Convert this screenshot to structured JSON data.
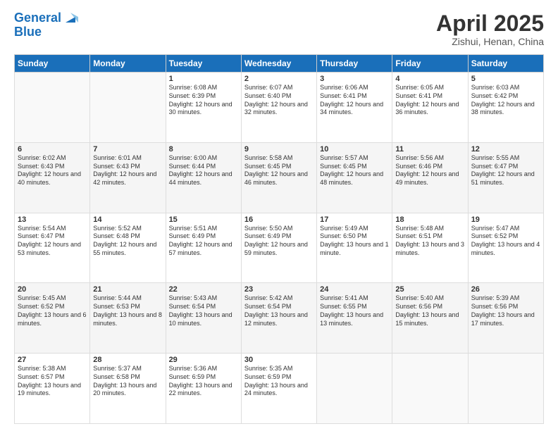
{
  "header": {
    "logo_line1": "General",
    "logo_line2": "Blue",
    "month_title": "April 2025",
    "subtitle": "Zishui, Henan, China"
  },
  "weekdays": [
    "Sunday",
    "Monday",
    "Tuesday",
    "Wednesday",
    "Thursday",
    "Friday",
    "Saturday"
  ],
  "weeks": [
    [
      {
        "day": "",
        "sunrise": "",
        "sunset": "",
        "daylight": ""
      },
      {
        "day": "",
        "sunrise": "",
        "sunset": "",
        "daylight": ""
      },
      {
        "day": "1",
        "sunrise": "Sunrise: 6:08 AM",
        "sunset": "Sunset: 6:39 PM",
        "daylight": "Daylight: 12 hours and 30 minutes."
      },
      {
        "day": "2",
        "sunrise": "Sunrise: 6:07 AM",
        "sunset": "Sunset: 6:40 PM",
        "daylight": "Daylight: 12 hours and 32 minutes."
      },
      {
        "day": "3",
        "sunrise": "Sunrise: 6:06 AM",
        "sunset": "Sunset: 6:41 PM",
        "daylight": "Daylight: 12 hours and 34 minutes."
      },
      {
        "day": "4",
        "sunrise": "Sunrise: 6:05 AM",
        "sunset": "Sunset: 6:41 PM",
        "daylight": "Daylight: 12 hours and 36 minutes."
      },
      {
        "day": "5",
        "sunrise": "Sunrise: 6:03 AM",
        "sunset": "Sunset: 6:42 PM",
        "daylight": "Daylight: 12 hours and 38 minutes."
      }
    ],
    [
      {
        "day": "6",
        "sunrise": "Sunrise: 6:02 AM",
        "sunset": "Sunset: 6:43 PM",
        "daylight": "Daylight: 12 hours and 40 minutes."
      },
      {
        "day": "7",
        "sunrise": "Sunrise: 6:01 AM",
        "sunset": "Sunset: 6:43 PM",
        "daylight": "Daylight: 12 hours and 42 minutes."
      },
      {
        "day": "8",
        "sunrise": "Sunrise: 6:00 AM",
        "sunset": "Sunset: 6:44 PM",
        "daylight": "Daylight: 12 hours and 44 minutes."
      },
      {
        "day": "9",
        "sunrise": "Sunrise: 5:58 AM",
        "sunset": "Sunset: 6:45 PM",
        "daylight": "Daylight: 12 hours and 46 minutes."
      },
      {
        "day": "10",
        "sunrise": "Sunrise: 5:57 AM",
        "sunset": "Sunset: 6:45 PM",
        "daylight": "Daylight: 12 hours and 48 minutes."
      },
      {
        "day": "11",
        "sunrise": "Sunrise: 5:56 AM",
        "sunset": "Sunset: 6:46 PM",
        "daylight": "Daylight: 12 hours and 49 minutes."
      },
      {
        "day": "12",
        "sunrise": "Sunrise: 5:55 AM",
        "sunset": "Sunset: 6:47 PM",
        "daylight": "Daylight: 12 hours and 51 minutes."
      }
    ],
    [
      {
        "day": "13",
        "sunrise": "Sunrise: 5:54 AM",
        "sunset": "Sunset: 6:47 PM",
        "daylight": "Daylight: 12 hours and 53 minutes."
      },
      {
        "day": "14",
        "sunrise": "Sunrise: 5:52 AM",
        "sunset": "Sunset: 6:48 PM",
        "daylight": "Daylight: 12 hours and 55 minutes."
      },
      {
        "day": "15",
        "sunrise": "Sunrise: 5:51 AM",
        "sunset": "Sunset: 6:49 PM",
        "daylight": "Daylight: 12 hours and 57 minutes."
      },
      {
        "day": "16",
        "sunrise": "Sunrise: 5:50 AM",
        "sunset": "Sunset: 6:49 PM",
        "daylight": "Daylight: 12 hours and 59 minutes."
      },
      {
        "day": "17",
        "sunrise": "Sunrise: 5:49 AM",
        "sunset": "Sunset: 6:50 PM",
        "daylight": "Daylight: 13 hours and 1 minute."
      },
      {
        "day": "18",
        "sunrise": "Sunrise: 5:48 AM",
        "sunset": "Sunset: 6:51 PM",
        "daylight": "Daylight: 13 hours and 3 minutes."
      },
      {
        "day": "19",
        "sunrise": "Sunrise: 5:47 AM",
        "sunset": "Sunset: 6:52 PM",
        "daylight": "Daylight: 13 hours and 4 minutes."
      }
    ],
    [
      {
        "day": "20",
        "sunrise": "Sunrise: 5:45 AM",
        "sunset": "Sunset: 6:52 PM",
        "daylight": "Daylight: 13 hours and 6 minutes."
      },
      {
        "day": "21",
        "sunrise": "Sunrise: 5:44 AM",
        "sunset": "Sunset: 6:53 PM",
        "daylight": "Daylight: 13 hours and 8 minutes."
      },
      {
        "day": "22",
        "sunrise": "Sunrise: 5:43 AM",
        "sunset": "Sunset: 6:54 PM",
        "daylight": "Daylight: 13 hours and 10 minutes."
      },
      {
        "day": "23",
        "sunrise": "Sunrise: 5:42 AM",
        "sunset": "Sunset: 6:54 PM",
        "daylight": "Daylight: 13 hours and 12 minutes."
      },
      {
        "day": "24",
        "sunrise": "Sunrise: 5:41 AM",
        "sunset": "Sunset: 6:55 PM",
        "daylight": "Daylight: 13 hours and 13 minutes."
      },
      {
        "day": "25",
        "sunrise": "Sunrise: 5:40 AM",
        "sunset": "Sunset: 6:56 PM",
        "daylight": "Daylight: 13 hours and 15 minutes."
      },
      {
        "day": "26",
        "sunrise": "Sunrise: 5:39 AM",
        "sunset": "Sunset: 6:56 PM",
        "daylight": "Daylight: 13 hours and 17 minutes."
      }
    ],
    [
      {
        "day": "27",
        "sunrise": "Sunrise: 5:38 AM",
        "sunset": "Sunset: 6:57 PM",
        "daylight": "Daylight: 13 hours and 19 minutes."
      },
      {
        "day": "28",
        "sunrise": "Sunrise: 5:37 AM",
        "sunset": "Sunset: 6:58 PM",
        "daylight": "Daylight: 13 hours and 20 minutes."
      },
      {
        "day": "29",
        "sunrise": "Sunrise: 5:36 AM",
        "sunset": "Sunset: 6:59 PM",
        "daylight": "Daylight: 13 hours and 22 minutes."
      },
      {
        "day": "30",
        "sunrise": "Sunrise: 5:35 AM",
        "sunset": "Sunset: 6:59 PM",
        "daylight": "Daylight: 13 hours and 24 minutes."
      },
      {
        "day": "",
        "sunrise": "",
        "sunset": "",
        "daylight": ""
      },
      {
        "day": "",
        "sunrise": "",
        "sunset": "",
        "daylight": ""
      },
      {
        "day": "",
        "sunrise": "",
        "sunset": "",
        "daylight": ""
      }
    ]
  ]
}
